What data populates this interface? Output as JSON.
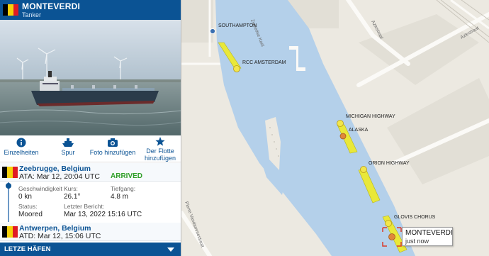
{
  "vessel": {
    "name": "MONTEVERDI",
    "type": "Tanker",
    "flag_colors": [
      "#000000",
      "#f5d10a",
      "#e01b24"
    ]
  },
  "actions": [
    {
      "label": "Einzelheiten",
      "icon": "info-icon"
    },
    {
      "label": "Spur",
      "icon": "ship-icon"
    },
    {
      "label": "Foto hinzufügen",
      "icon": "camera-icon"
    },
    {
      "label_line1": "Der Flotte",
      "label_line2": "hinzufügen",
      "icon": "star-icon"
    }
  ],
  "arrival_port": {
    "name": "Zeebrugge, Belgium",
    "time": "ATA: Mar 12, 20:04 UTC",
    "status": "ARRIVED"
  },
  "details": {
    "speed_label": "Geschwindigkeit",
    "speed_value": "0 kn",
    "course_label": "Kurs:",
    "course_value": "26.1°",
    "draught_label": "Tiefgang:",
    "draught_value": "4.8 m",
    "status_label": "Status:",
    "status_value": "Moored",
    "last_report_label": "Letzter Bericht:",
    "last_report_value": "Mar 13, 2022 15:16 UTC"
  },
  "departure_port": {
    "name": "Antwerpen, Belgium",
    "time": "ATD: Mar 12, 15:06 UTC"
  },
  "footer": {
    "label": "LETZE HÄFEN"
  },
  "map": {
    "streets": [
      "Zweedse Kaai",
      "Zweedse Kaai",
      "Azlestraat",
      "Azlestraat",
      "Pierre Vandammestraat",
      "Nordzeestraat"
    ],
    "ship_labels": [
      "SOUTHAMPTON",
      "RCC AMSTERDAM",
      "MICHIGAN HIGHWAY",
      "ALASKA",
      "ORION HIGHWAY",
      "GLOVIS CHORUS"
    ],
    "selected": {
      "name": "MONTEVERDI",
      "time": "just now"
    },
    "colors": {
      "water": "#b4d0ea",
      "land": "#ece9e1",
      "ship": "#e9e839",
      "accent": "#d93b2b"
    }
  }
}
